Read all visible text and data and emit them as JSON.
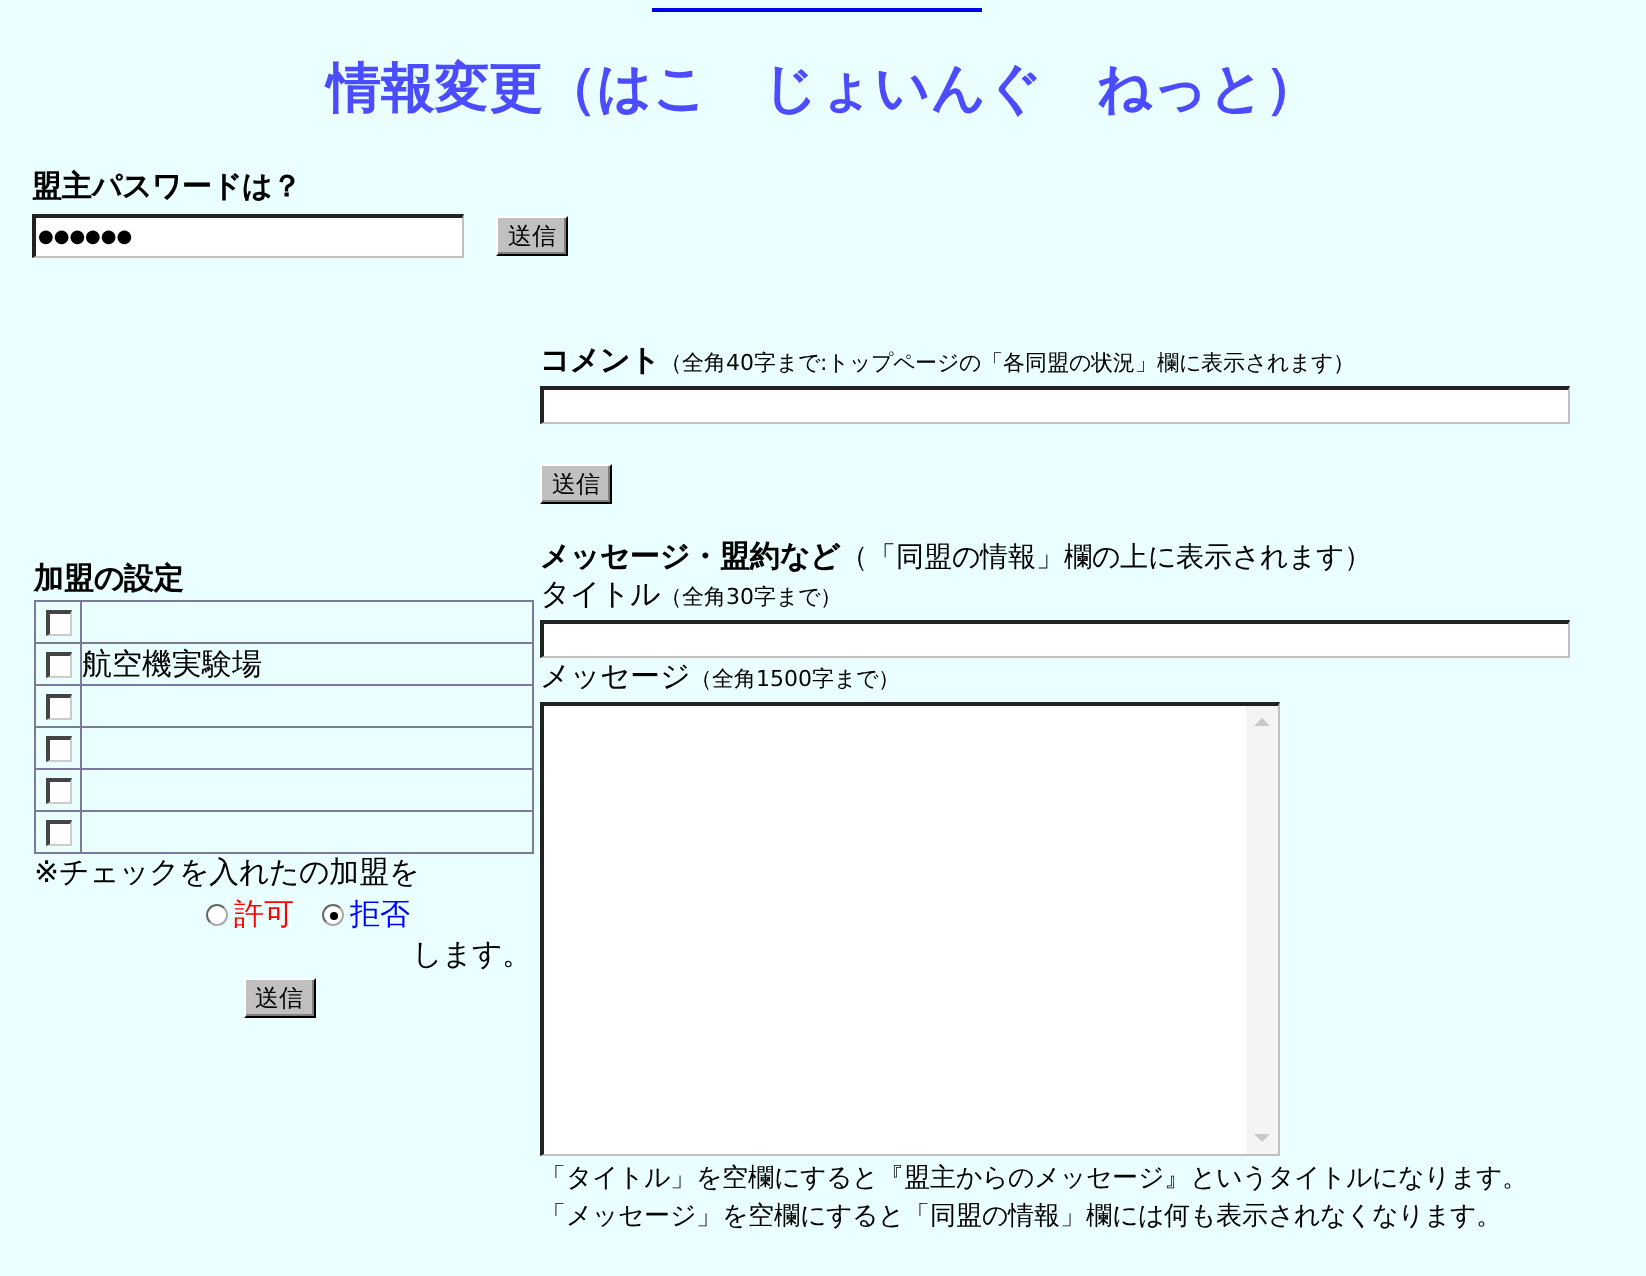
{
  "header": {
    "title": "情報変更（はこ　じょいんぐ　ねっと）"
  },
  "password": {
    "label": "盟主パスワードは？",
    "value": "●●●●●●",
    "button": "送信"
  },
  "membership": {
    "heading": "加盟の設定",
    "rows": [
      {
        "checked": false
      },
      {
        "checked": false,
        "name": "航空機実験場"
      },
      {
        "checked": false
      },
      {
        "checked": false
      },
      {
        "checked": false
      },
      {
        "checked": false
      }
    ],
    "note": "※チェックを入れたの加盟を",
    "options": [
      {
        "label": "許可",
        "selected": false,
        "color": "#ff0000"
      },
      {
        "label": "拒否",
        "selected": true,
        "color": "#0000ff"
      }
    ],
    "suffix": "します。",
    "button": "送信"
  },
  "comment": {
    "label": "コメント",
    "hint": "（全角40字まで:トップページの「各同盟の状況」欄に表示されます）",
    "button": "送信"
  },
  "message": {
    "heading": "メッセージ・盟約など",
    "heading_hint": "（「同盟の情報」欄の上に表示されます）",
    "title_label": "タイトル",
    "title_hint": "（全角30字まで）",
    "body_label": "メッセージ",
    "body_hint": "（全角1500字まで）",
    "notes": [
      "「タイトル」を空欄にすると『盟主からのメッセージ』というタイトルになります。",
      "「メッセージ」を空欄にすると「同盟の情報」欄には何も表示されなくなります。"
    ]
  }
}
